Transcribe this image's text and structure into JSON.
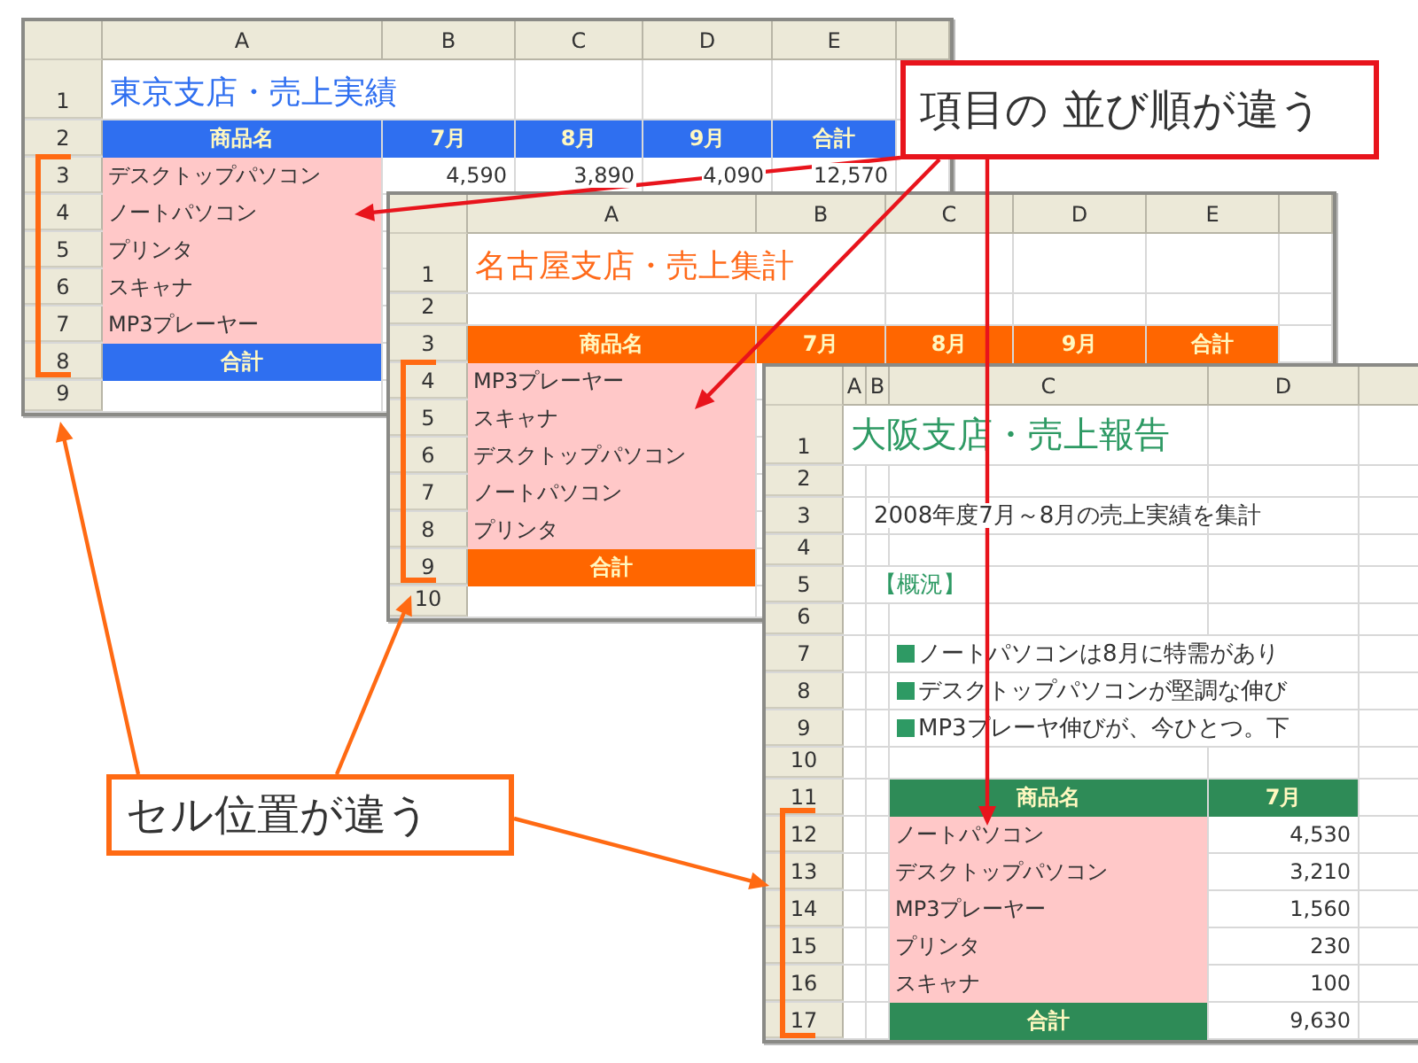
{
  "sheets": [
    {
      "columns": [
        "A",
        "B",
        "C",
        "D",
        "E"
      ],
      "rows": [
        {
          "num": "1",
          "kind": "title",
          "text": "東京支店・売上実績"
        },
        {
          "num": "2",
          "kind": "header",
          "cells": [
            "商品名",
            "7月",
            "8月",
            "9月",
            "合計"
          ]
        },
        {
          "num": "3",
          "kind": "item",
          "cells": [
            "デスクトップパソコン",
            "4,590",
            "3,890",
            "4,090",
            "12,570"
          ]
        },
        {
          "num": "4",
          "kind": "item",
          "cells": [
            "ノートパソコン"
          ]
        },
        {
          "num": "5",
          "kind": "item",
          "cells": [
            "プリンタ"
          ]
        },
        {
          "num": "6",
          "kind": "item",
          "cells": [
            "スキャナ"
          ]
        },
        {
          "num": "7",
          "kind": "item",
          "cells": [
            "MP3プレーヤー"
          ]
        },
        {
          "num": "8",
          "kind": "total",
          "cells": [
            "合計"
          ]
        },
        {
          "num": "9",
          "kind": "blank"
        }
      ]
    },
    {
      "columns": [
        "A",
        "B",
        "C",
        "D",
        "E"
      ],
      "rows": [
        {
          "num": "1",
          "kind": "title",
          "text": "名古屋支店・売上集計"
        },
        {
          "num": "2",
          "kind": "blank"
        },
        {
          "num": "3",
          "kind": "header",
          "cells": [
            "商品名",
            "7月",
            "8月",
            "9月",
            "合計"
          ]
        },
        {
          "num": "4",
          "kind": "item",
          "cells": [
            "MP3プレーヤー"
          ]
        },
        {
          "num": "5",
          "kind": "item",
          "cells": [
            "スキャナ"
          ]
        },
        {
          "num": "6",
          "kind": "item",
          "cells": [
            "デスクトップパソコン"
          ]
        },
        {
          "num": "7",
          "kind": "item",
          "cells": [
            "ノートパソコン"
          ]
        },
        {
          "num": "8",
          "kind": "item",
          "cells": [
            "プリンタ"
          ]
        },
        {
          "num": "9",
          "kind": "total",
          "cells": [
            "合計"
          ]
        },
        {
          "num": "10",
          "kind": "blank"
        }
      ]
    },
    {
      "columns": [
        "A",
        "B",
        "C",
        "D"
      ],
      "rows": [
        {
          "num": "1",
          "kind": "title",
          "text": "大阪支店・売上報告"
        },
        {
          "num": "2",
          "kind": "blank"
        },
        {
          "num": "3",
          "kind": "note",
          "text": "2008年度7月～8月の売上実績を集計"
        },
        {
          "num": "4",
          "kind": "blank"
        },
        {
          "num": "5",
          "kind": "section",
          "text": "【概況】"
        },
        {
          "num": "6",
          "kind": "blank"
        },
        {
          "num": "7",
          "kind": "bullet",
          "text": "ノートパソコンは8月に特需があり"
        },
        {
          "num": "8",
          "kind": "bullet",
          "text": "デスクトップパソコンが堅調な伸び"
        },
        {
          "num": "9",
          "kind": "bullet",
          "text": "MP3プレーヤ伸びが、今ひとつ。下"
        },
        {
          "num": "10",
          "kind": "blank"
        },
        {
          "num": "11",
          "kind": "header",
          "cells": [
            "商品名",
            "7月"
          ]
        },
        {
          "num": "12",
          "kind": "item",
          "cells": [
            "ノートパソコン",
            "4,530"
          ]
        },
        {
          "num": "13",
          "kind": "item",
          "cells": [
            "デスクトップパソコン",
            "3,210"
          ]
        },
        {
          "num": "14",
          "kind": "item",
          "cells": [
            "MP3プレーヤー",
            "1,560"
          ]
        },
        {
          "num": "15",
          "kind": "item",
          "cells": [
            "プリンタ",
            "230"
          ]
        },
        {
          "num": "16",
          "kind": "item",
          "cells": [
            "スキャナ",
            "100"
          ]
        },
        {
          "num": "17",
          "kind": "total",
          "cells": [
            "合計",
            "9,630"
          ]
        }
      ]
    }
  ],
  "callouts": [
    {
      "text": "項目の 並び順が違う"
    },
    {
      "text": "セル位置が違う"
    }
  ]
}
